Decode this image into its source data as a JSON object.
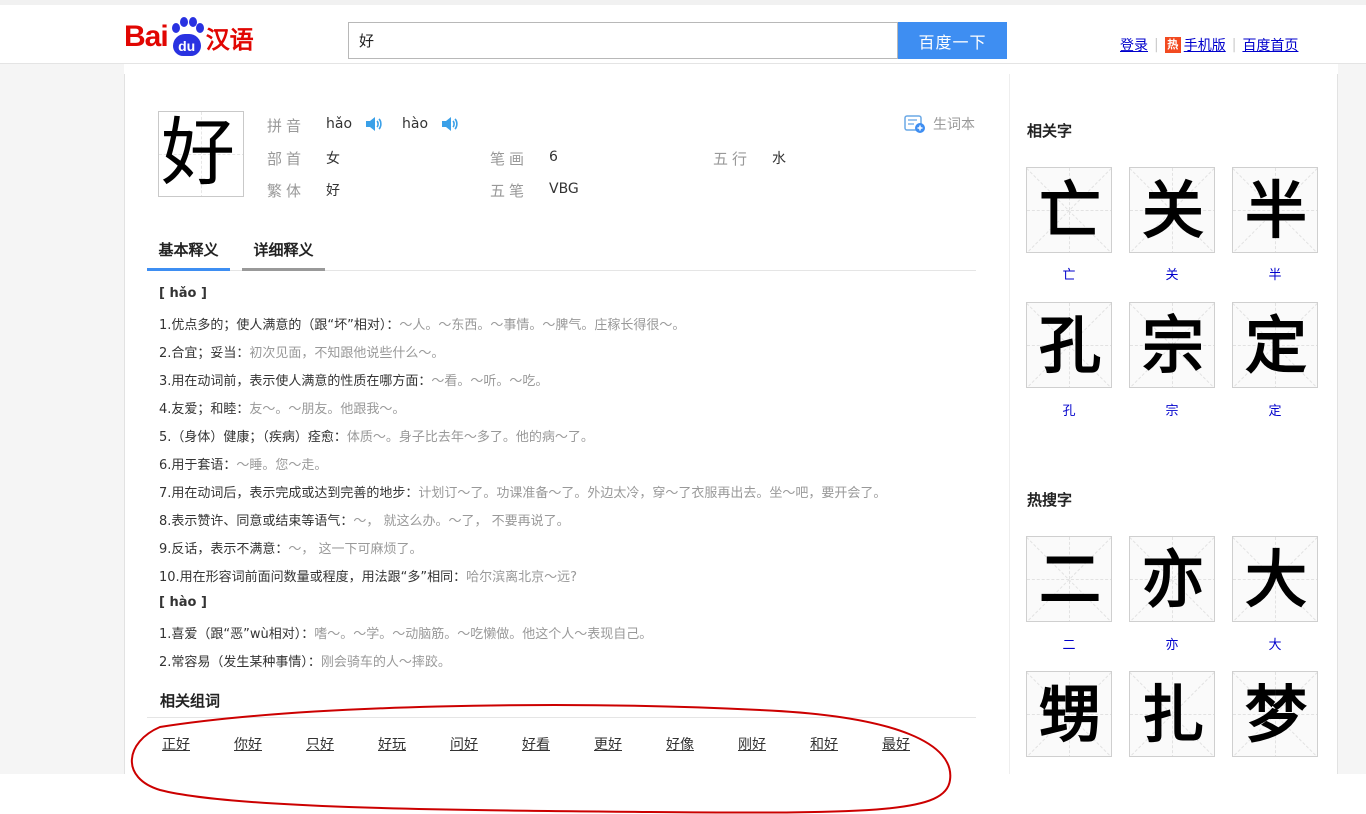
{
  "header": {
    "logo_text": "Bai",
    "logo_paw_text": "du",
    "logo_cn": "汉语",
    "search_value": "好",
    "search_button": "百度一下",
    "links": {
      "login": "登录",
      "hot_badge": "热",
      "mobile": "手机版",
      "home": "百度首页"
    }
  },
  "character": {
    "glyph": "好",
    "pinyin_label": "拼音",
    "pinyin": [
      "hǎo",
      "hào"
    ],
    "radical_label": "部首",
    "radical": "女",
    "strokes_label": "笔画",
    "strokes": "6",
    "wuxing_label": "五行",
    "wuxing": "水",
    "traditional_label": "繁体",
    "traditional": "好",
    "wubi_label": "五笔",
    "wubi": "VBG",
    "vocab_button": "生词本"
  },
  "tabs": [
    "基本释义",
    "详细释义"
  ],
  "definitions": [
    {
      "main": "[ hǎo ]",
      "ex": "",
      "head": true
    },
    {
      "main": "1.优点多的；使人满意的（跟“坏”相对）：",
      "ex": "～人。～东西。～事情。～脾气。庄稼长得很～。"
    },
    {
      "main": "2.合宜；妥当：",
      "ex": "初次见面，不知跟他说些什么～。"
    },
    {
      "main": "3.用在动词前，表示使人满意的性质在哪方面：",
      "ex": "～看。～听。～吃。"
    },
    {
      "main": "4.友爱；和睦：",
      "ex": "友～。～朋友。他跟我～。"
    },
    {
      "main": "5.（身体）健康；（疾病）痊愈：",
      "ex": "体质～。身子比去年～多了。他的病～了。"
    },
    {
      "main": "6.用于套语：",
      "ex": "～睡。您～走。"
    },
    {
      "main": "7.用在动词后，表示完成或达到完善的地步：",
      "ex": "计划订～了。功课准备～了。外边太冷，穿～了衣服再出去。坐～吧，要开会了。"
    },
    {
      "main": "8.表示赞许、同意或结束等语气：",
      "ex": "～，  就这么办。～了，  不要再说了。"
    },
    {
      "main": "9.反话，表示不满意：",
      "ex": "～，  这一下可麻烦了。"
    },
    {
      "main": "10.用在形容词前面问数量或程度，用法跟“多”相同：",
      "ex": "哈尔滨离北京～远?"
    },
    {
      "main": "[ hào ]",
      "ex": "",
      "head": true
    },
    {
      "main": "1.喜爱（跟“恶”wù相对）：",
      "ex": "嗜～。～学。～动脑筋。～吃懒做。他这个人～表现自己。"
    },
    {
      "main": "2.常容易（发生某种事情）：",
      "ex": "刚会骑车的人～摔跤。"
    }
  ],
  "related_words_title": "相关组词",
  "related_words": [
    "正好",
    "你好",
    "只好",
    "好玩",
    "问好",
    "好看",
    "更好",
    "好像",
    "刚好",
    "和好",
    "最好"
  ],
  "side": {
    "related_title": "相关字",
    "related_chars": [
      "亡",
      "关",
      "半",
      "孔",
      "宗",
      "定"
    ],
    "hot_title": "热搜字",
    "hot_chars": [
      "二",
      "亦",
      "大",
      "甥",
      "扎",
      "梦"
    ]
  },
  "colors": {
    "accent": "#3e8ef2",
    "logo_red": "#e10602",
    "logo_blue": "#2932e1",
    "link": "#0000cc",
    "annotation": "#cc0000"
  }
}
